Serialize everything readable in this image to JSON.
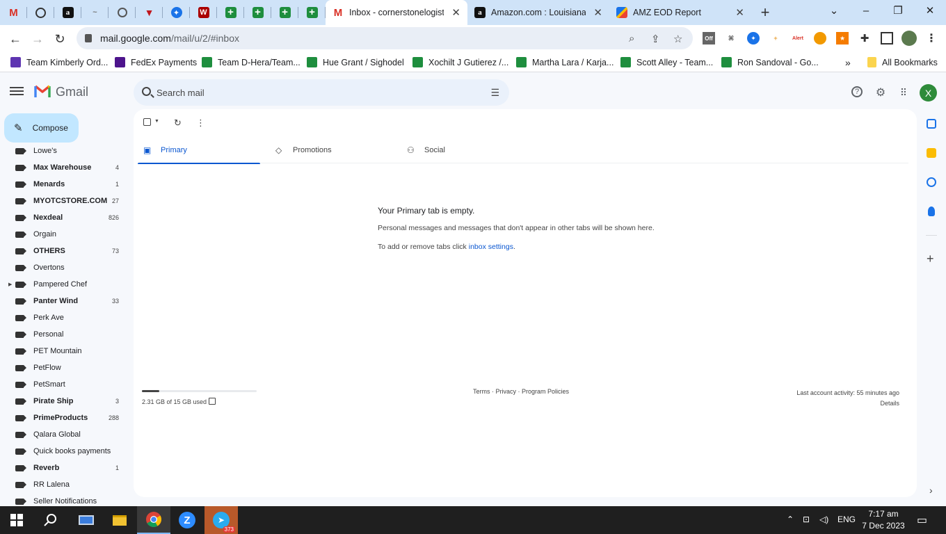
{
  "browser": {
    "tabs": [
      {
        "title": "Inbox - cornerstonelogisti",
        "active": true
      },
      {
        "title": "Amazon.com : Louisiana F",
        "active": false
      },
      {
        "title": "AMZ EOD Report",
        "active": false
      }
    ],
    "url": {
      "host": "mail.google.com",
      "path": "/mail/u/2/#inbox"
    },
    "extension_badges": {
      "off": "Off",
      "alert": "Alert"
    }
  },
  "bookmarks": [
    "Team Kimberly Ord...",
    "FedEx Payments",
    "Team D-Hera/Team...",
    "Hue Grant / Sighodel",
    "Xochilt J Gutierez /...",
    "Martha Lara / Karja...",
    "Scott Alley - Team...",
    "Ron Sandoval - Go..."
  ],
  "all_bookmarks": "All Bookmarks",
  "gmail": {
    "brand": "Gmail",
    "search_placeholder": "Search mail",
    "avatar_letter": "X",
    "compose": "Compose",
    "labels": [
      {
        "name": "Lowe's",
        "count": "",
        "bold": false
      },
      {
        "name": "Max Warehouse",
        "count": "4",
        "bold": true
      },
      {
        "name": "Menards",
        "count": "1",
        "bold": true
      },
      {
        "name": "MYOTCSTORE.COM",
        "count": "27",
        "bold": true
      },
      {
        "name": "Nexdeal",
        "count": "826",
        "bold": true
      },
      {
        "name": "Orgain",
        "count": "",
        "bold": false
      },
      {
        "name": "OTHERS",
        "count": "73",
        "bold": true
      },
      {
        "name": "Overtons",
        "count": "",
        "bold": false
      },
      {
        "name": "Pampered Chef",
        "count": "",
        "bold": false,
        "expandable": true
      },
      {
        "name": "Panter Wind",
        "count": "33",
        "bold": true
      },
      {
        "name": "Perk Ave",
        "count": "",
        "bold": false
      },
      {
        "name": "Personal",
        "count": "",
        "bold": false
      },
      {
        "name": "PET Mountain",
        "count": "",
        "bold": false
      },
      {
        "name": "PetFlow",
        "count": "",
        "bold": false
      },
      {
        "name": "PetSmart",
        "count": "",
        "bold": false
      },
      {
        "name": "Pirate Ship",
        "count": "3",
        "bold": true
      },
      {
        "name": "PrimeProducts",
        "count": "288",
        "bold": true
      },
      {
        "name": "Qalara Global",
        "count": "",
        "bold": false
      },
      {
        "name": "Quick books payments",
        "count": "",
        "bold": false
      },
      {
        "name": "Reverb",
        "count": "1",
        "bold": true
      },
      {
        "name": "RR Lalena",
        "count": "",
        "bold": false
      },
      {
        "name": "Seller Notifications",
        "count": "",
        "bold": false
      }
    ],
    "inbox_tabs": [
      "Primary",
      "Promotions",
      "Social"
    ],
    "empty": {
      "title": "Your Primary tab is empty.",
      "description": "Personal messages and messages that don't appear in other tabs will be shown here.",
      "settings_prefix": "To add or remove tabs click ",
      "settings_link": "inbox settings",
      "settings_suffix": "."
    },
    "storage": {
      "text": "2.31 GB of 15 GB used",
      "fraction": 0.154
    },
    "footer_links": "Terms · Privacy · Program Policies",
    "activity": {
      "text": "Last account activity: 55 minutes ago",
      "details": "Details"
    }
  },
  "taskbar": {
    "telegram_badge": "373",
    "language": "ENG",
    "time": "7:17 am",
    "date": "7 Dec 2023"
  },
  "colors": {
    "accent": "#0b57d0",
    "compose_bg": "#c2e7ff",
    "tabstrip": "#cfe3f8"
  }
}
